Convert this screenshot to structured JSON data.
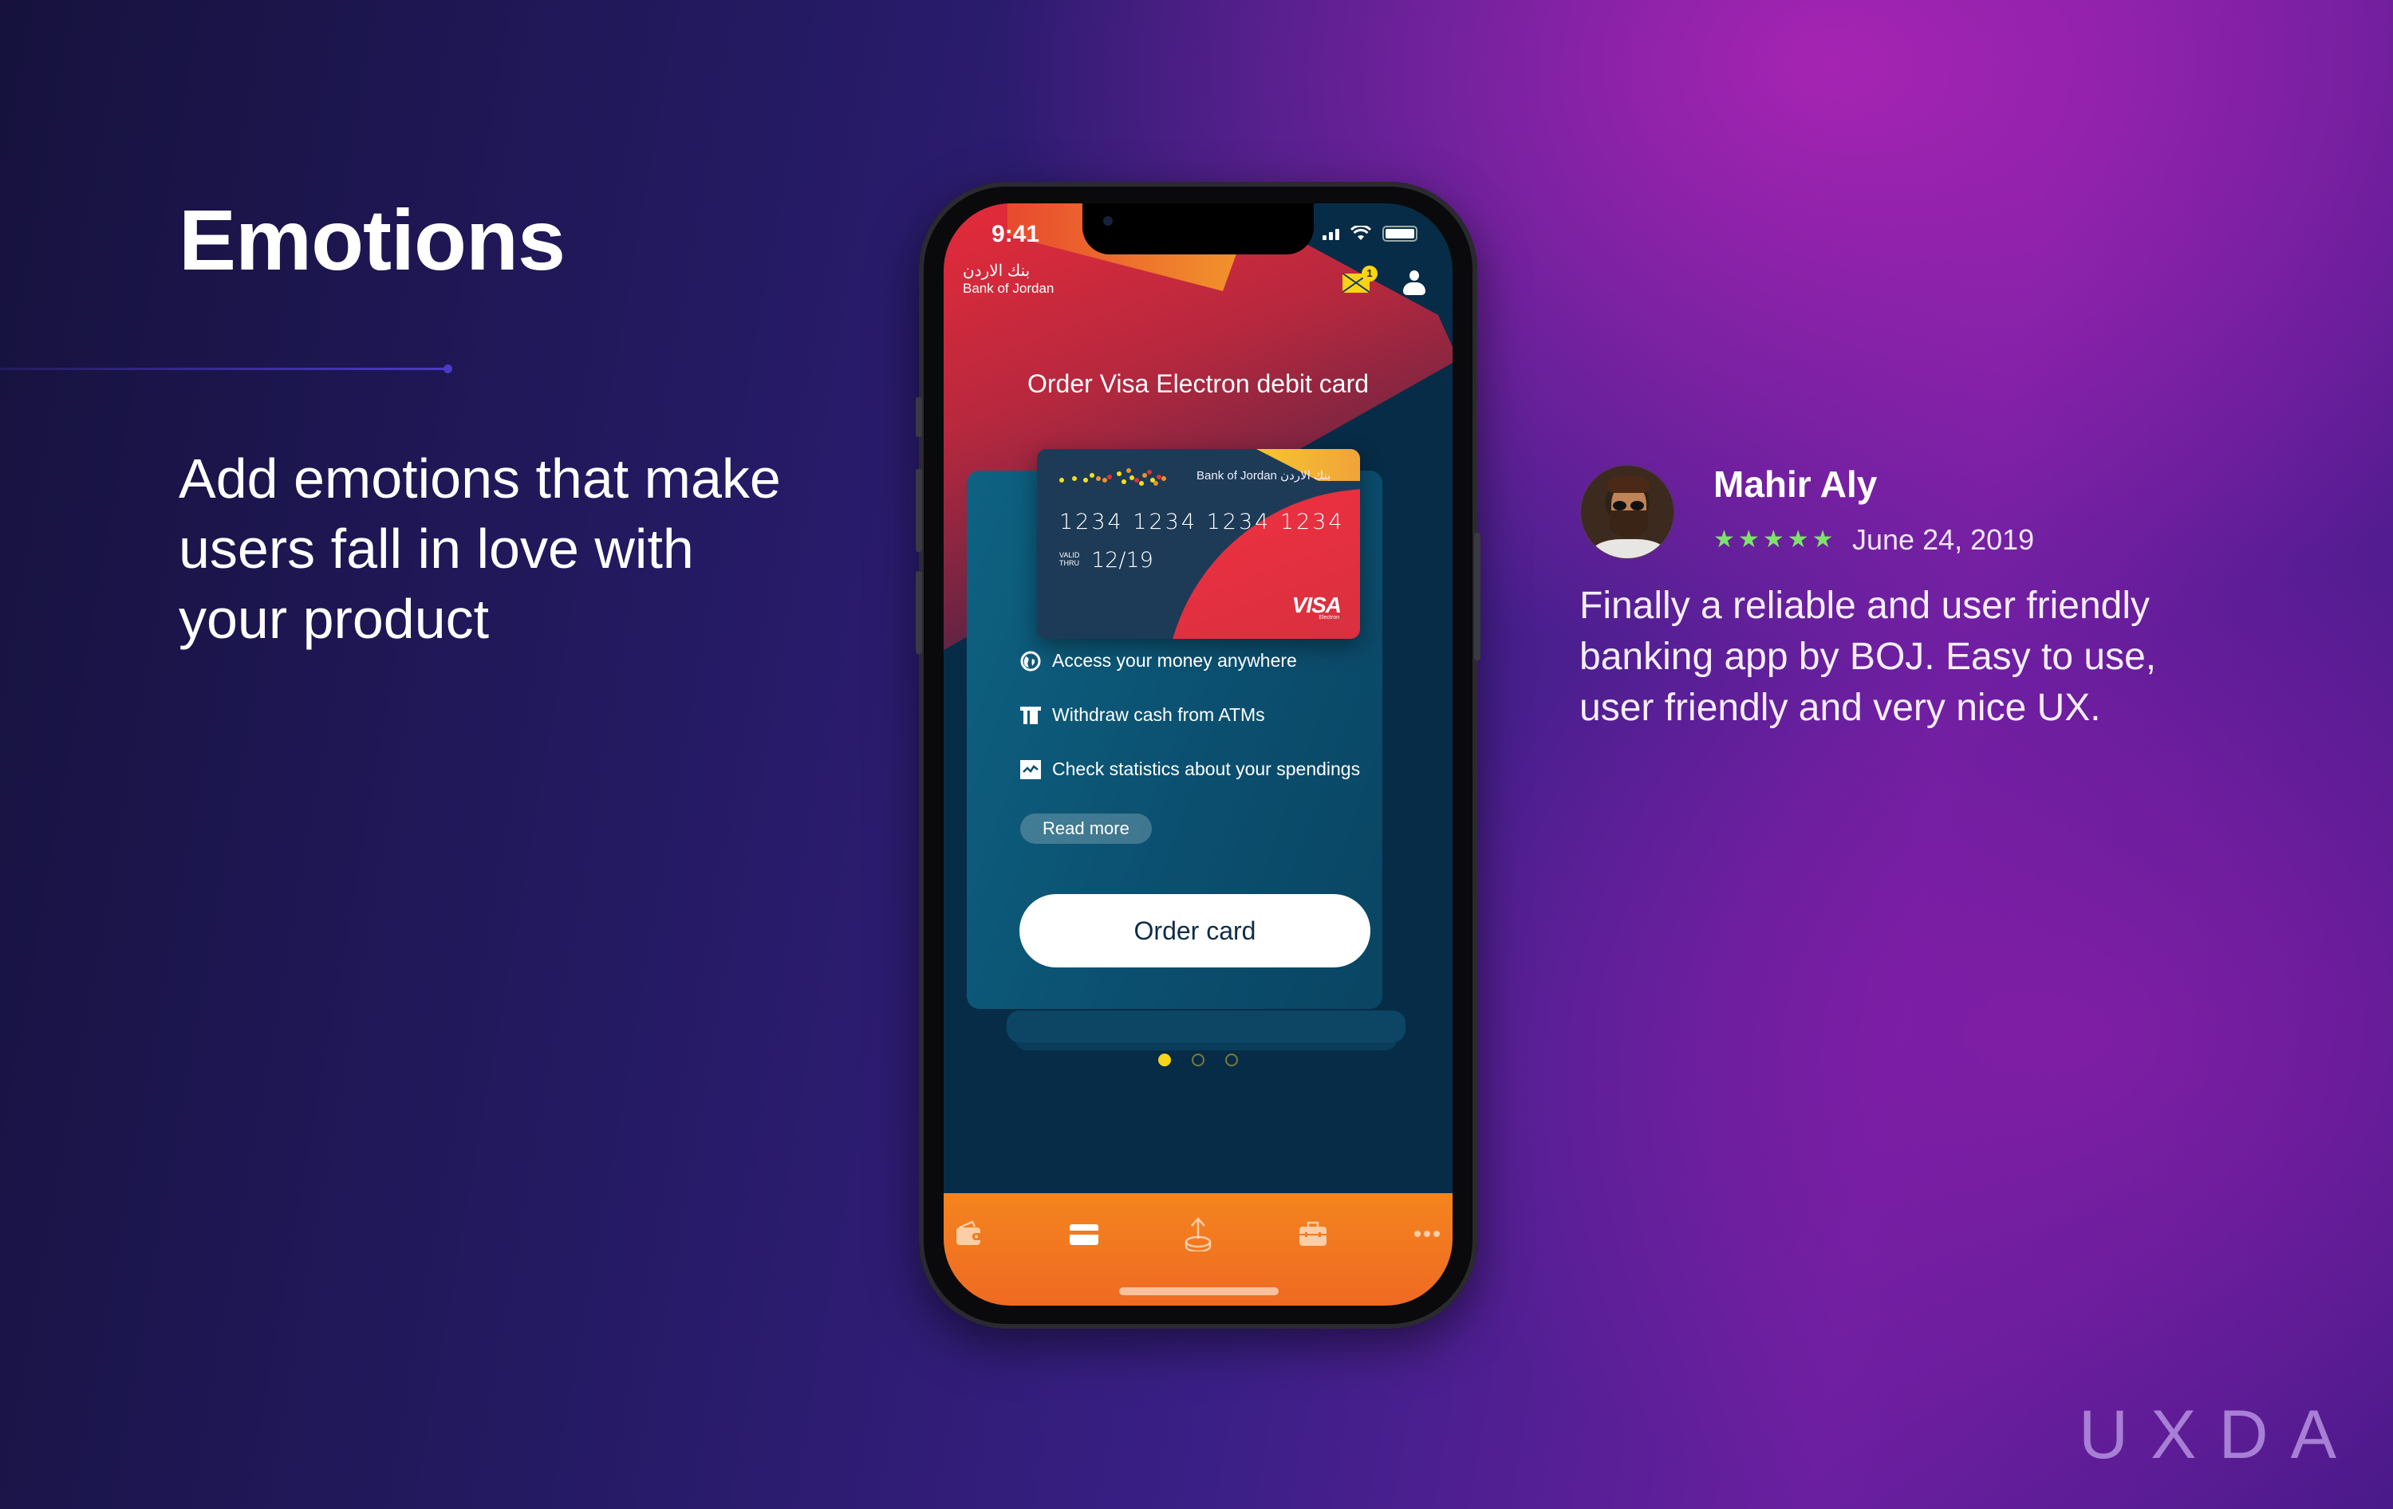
{
  "slide": {
    "headline": "Emotions",
    "subtext": "Add emotions that make users fall in love with your product",
    "logo": "UXDA"
  },
  "review": {
    "name": "Mahir Aly",
    "rating": 5,
    "rating_max": 5,
    "date": "June 24, 2019",
    "text": "Finally a reliable and user friendly banking app by BOJ. Easy to use, user friendly and very nice UX.",
    "star_color": "#7ee36a"
  },
  "phone": {
    "status_bar": {
      "time": "9:41"
    },
    "header": {
      "bank_name_ar": "بنك الاردن",
      "bank_name_en": "Bank of Jordan",
      "mail_badge_count": "1"
    },
    "offer": {
      "title": "Order Visa Electron debit card",
      "card": {
        "bank_label": "Bank of Jordan  بنك الاردن",
        "number": "1234 1234 1234 1234",
        "valid_label_1": "VALID",
        "valid_label_2": "THRU",
        "expiry": "12/19",
        "brand": "VISA",
        "brand_sub": "Electron"
      },
      "features": [
        {
          "icon": "globe-icon",
          "label": "Access your money anywhere"
        },
        {
          "icon": "atm-icon",
          "label": "Withdraw cash from ATMs"
        },
        {
          "icon": "chart-icon",
          "label": "Check statistics about your spendings"
        }
      ],
      "read_more_label": "Read more",
      "order_button_label": "Order card"
    },
    "pager": {
      "count": 3,
      "active_index": 0
    },
    "tabbar": {
      "items": [
        {
          "icon": "wallet-icon",
          "active": false
        },
        {
          "icon": "card-icon",
          "active": true
        },
        {
          "icon": "transfer-icon",
          "active": false
        },
        {
          "icon": "briefcase-icon",
          "active": false
        },
        {
          "icon": "more-icon",
          "active": false
        }
      ]
    }
  },
  "colors": {
    "accent_yellow": "#f7d417",
    "tabbar_orange": "#f4841e",
    "screen_navy": "#072c47"
  }
}
